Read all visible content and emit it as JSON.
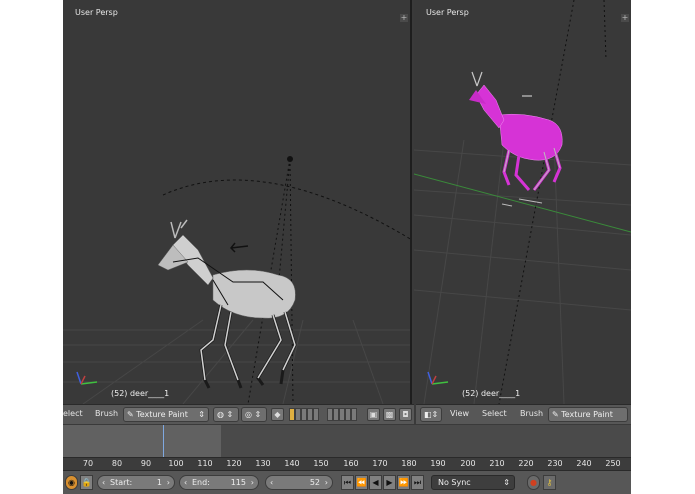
{
  "viewports": {
    "left": {
      "title": "User Persp",
      "status": "(52) deer____1"
    },
    "right": {
      "title": "User Persp",
      "status": "(52) deer____1"
    }
  },
  "header_left": {
    "select_label": "elect",
    "brush_label": "Brush",
    "mode_label": "Texture Paint"
  },
  "header_right": {
    "view_label": "View",
    "select_label": "Select",
    "brush_label": "Brush",
    "mode_label": "Texture Paint"
  },
  "timeline": {
    "ticks": [
      "70",
      "80",
      "90",
      "100",
      "110",
      "120",
      "130",
      "140",
      "150",
      "160",
      "170",
      "180",
      "190",
      "200",
      "210",
      "220",
      "230",
      "240",
      "250"
    ]
  },
  "playback": {
    "start_label": "Start:",
    "start_value": "1",
    "end_label": "End:",
    "end_value": "115",
    "current_frame": "52",
    "sync_label": "No Sync",
    "transport_icons": [
      "jump-start-icon",
      "prev-keyframe-icon",
      "play-reverse-icon",
      "play-icon",
      "next-keyframe-icon",
      "jump-end-icon"
    ]
  },
  "colors": {
    "paint_magenta": "#d633d6",
    "axis_red": "#c04040",
    "axis_green": "#40c040",
    "axis_blue": "#4060e0",
    "accent_blue": "#5680c2",
    "record_red": "#d04020"
  }
}
